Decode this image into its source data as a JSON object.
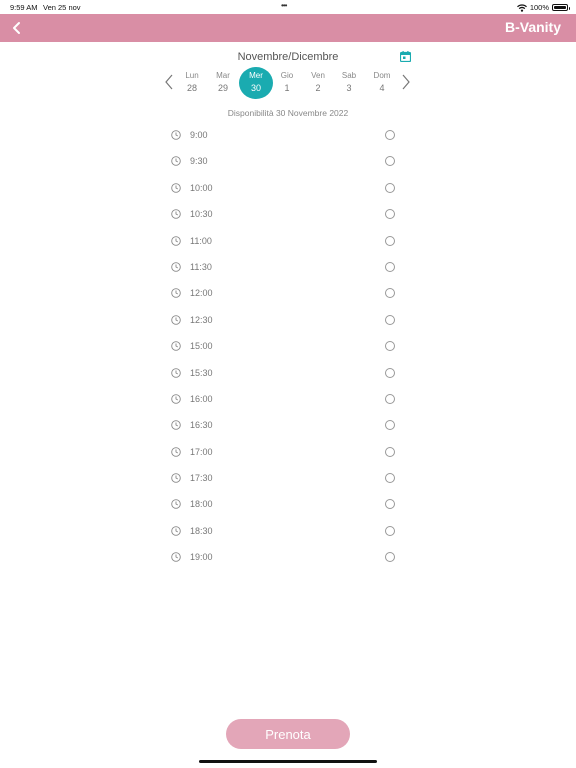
{
  "status_bar": {
    "time": "9:59 AM",
    "date": "Ven 25 nov",
    "battery": "100%"
  },
  "header": {
    "title": "B-Vanity"
  },
  "calendar": {
    "month": "Novembre/Dicembre",
    "days": [
      {
        "name": "Lun",
        "num": "28"
      },
      {
        "name": "Mar",
        "num": "29"
      },
      {
        "name": "Mer",
        "num": "30"
      },
      {
        "name": "Gio",
        "num": "1"
      },
      {
        "name": "Ven",
        "num": "2"
      },
      {
        "name": "Sab",
        "num": "3"
      },
      {
        "name": "Dom",
        "num": "4"
      }
    ],
    "selected_day": "30"
  },
  "availability": "Disponibilità 30 Novembre 2022",
  "slots": [
    "9:00",
    "9:30",
    "10:00",
    "10:30",
    "11:00",
    "11:30",
    "12:00",
    "12:30",
    "15:00",
    "15:30",
    "16:00",
    "16:30",
    "17:00",
    "17:30",
    "18:00",
    "18:30",
    "19:00"
  ],
  "book_button": "Prenota",
  "colors": {
    "header": "#d98ea5",
    "selected": "#1aabb0",
    "button": "#e3a6b8"
  }
}
